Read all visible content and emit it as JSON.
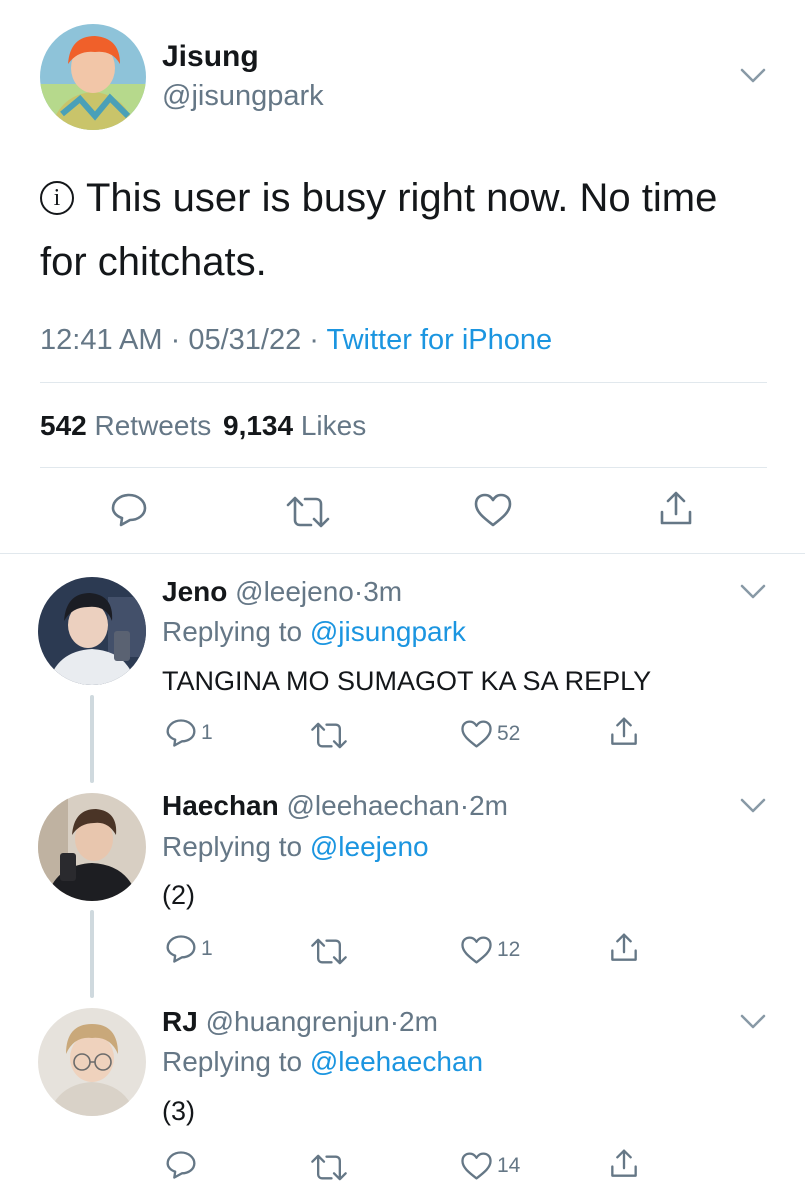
{
  "tweet": {
    "name": "Jisung",
    "handle": "@jisungpark",
    "info_glyph": "i",
    "text_line1": "This user is busy right now. No time",
    "text_line2": "for chitchats.",
    "time": "12:41 AM",
    "sep1": "·",
    "date": "05/31/22",
    "sep2": "·",
    "source": "Twitter for iPhone",
    "retweets_count": "542",
    "retweets_label": "Retweets",
    "likes_count": "9,134",
    "likes_label": "Likes"
  },
  "replies": [
    {
      "name": "Jeno",
      "handle": "@leejeno",
      "sep": "·",
      "age": "3m",
      "replying_prefix": "Replying to",
      "replying_to": "@jisungpark",
      "text": "TANGINA MO SUMAGOT KA SA REPLY",
      "reply_count": "1",
      "like_count": "52"
    },
    {
      "name": "Haechan",
      "handle": "@leehaechan",
      "sep": "·",
      "age": "2m",
      "replying_prefix": "Replying to",
      "replying_to": "@leejeno",
      "text": "(2)",
      "reply_count": "1",
      "like_count": "12"
    },
    {
      "name": "RJ",
      "handle": "@huangrenjun",
      "sep": "·",
      "age": "2m",
      "replying_prefix": "Replying to",
      "replying_to": "@leehaechan",
      "text": "(3)",
      "reply_count": "",
      "like_count": "14"
    }
  ],
  "colors": {
    "link_blue": "#1b95e0",
    "secondary_gray": "#657786",
    "divider": "#e1e8ed"
  },
  "icons": [
    "caret-down-icon",
    "info-icon",
    "reply-icon",
    "retweet-icon",
    "like-icon",
    "share-icon"
  ]
}
